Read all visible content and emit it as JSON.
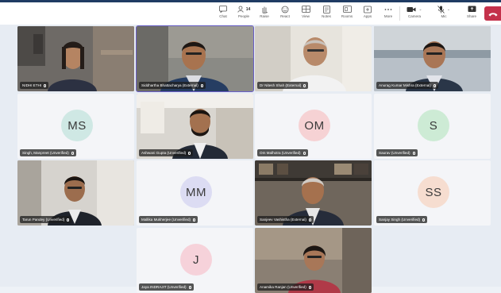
{
  "toolbar": {
    "items": [
      {
        "label": "Chat",
        "icon": "chat-icon"
      },
      {
        "label": "People",
        "icon": "people-icon",
        "count": "14"
      },
      {
        "label": "Raise",
        "icon": "hand-icon"
      },
      {
        "label": "React",
        "icon": "react-icon"
      },
      {
        "label": "View",
        "icon": "view-icon"
      },
      {
        "label": "Notes",
        "icon": "notes-icon"
      },
      {
        "label": "Rooms",
        "icon": "rooms-icon"
      },
      {
        "label": "Apps",
        "icon": "apps-icon"
      },
      {
        "label": "More",
        "icon": "more-icon"
      },
      {
        "label": "Camera",
        "icon": "camera-icon"
      },
      {
        "label": "Mic",
        "icon": "mic-icon"
      },
      {
        "label": "Share",
        "icon": "share-icon"
      }
    ],
    "leave_icon": "phone-hangup-icon",
    "leave_color": "#c4314b"
  },
  "participants": [
    {
      "name": "NIDHI ETHI",
      "type": "video"
    },
    {
      "name": "Siddhartha Bhattacharya (External)",
      "type": "video",
      "active": true
    },
    {
      "name": "Dr Nitesh Shah (External)",
      "type": "video"
    },
    {
      "name": "Anurag Kumar Mishra (External)",
      "type": "video"
    },
    {
      "name": "Singh, Manpreet (Unverified)",
      "type": "avatar",
      "initials": "MS",
      "color": "#cfe8e4"
    },
    {
      "name": "Ashwani Gupta (Unverified)",
      "type": "video"
    },
    {
      "name": "Om Malhotra (Unverified)",
      "type": "avatar",
      "initials": "OM",
      "color": "#f6d2d4"
    },
    {
      "name": "Saurav (Unverified)",
      "type": "avatar",
      "initials": "S",
      "color": "#cdebd5"
    },
    {
      "name": "Tarun Pandey (Unverified)",
      "type": "video"
    },
    {
      "name": "Mallika Mukherjee (Unverified)",
      "type": "avatar",
      "initials": "MM",
      "color": "#dcdcf3"
    },
    {
      "name": "Sanjeev Vashistha (External)",
      "type": "video"
    },
    {
      "name": "Sanjay Singh (Unverified)",
      "type": "avatar",
      "initials": "SS",
      "color": "#f6ddd0"
    },
    {
      "name": "Jaya INDRAJIT (Unverified)",
      "type": "avatar",
      "initials": "J",
      "color": "#f6d2da"
    },
    {
      "name": "Anamika Ranjan (Unverified)",
      "type": "video"
    }
  ]
}
